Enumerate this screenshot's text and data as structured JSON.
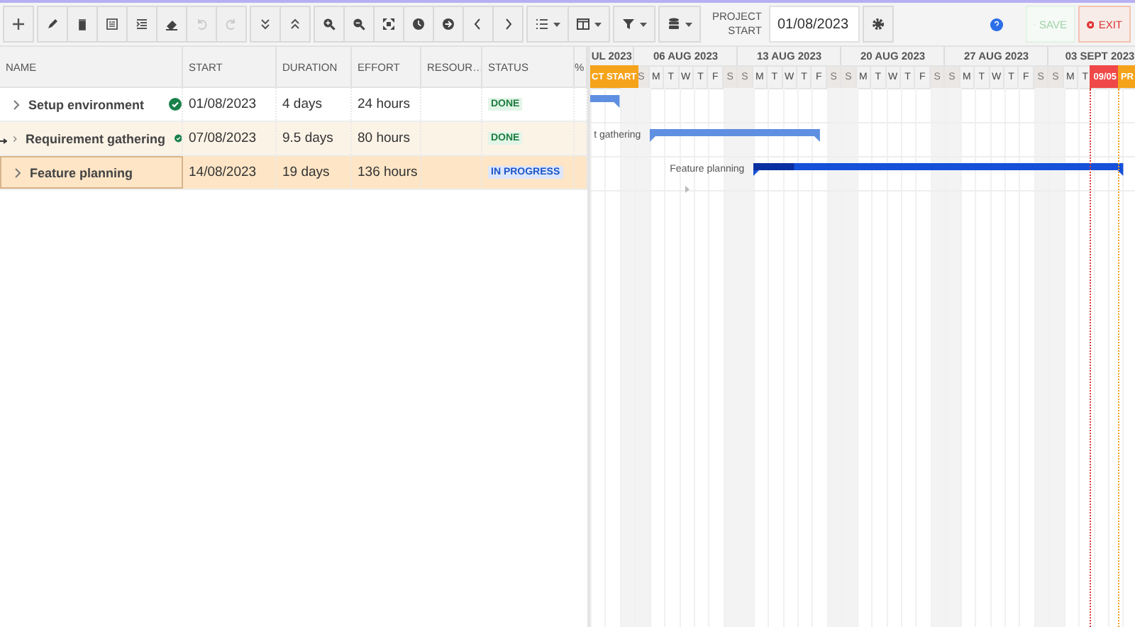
{
  "toolbar": {
    "groups": [
      [
        {
          "kind": "add",
          "disabled": false
        }
      ],
      [
        {
          "kind": "edit",
          "disabled": false
        },
        {
          "kind": "delete",
          "disabled": false
        },
        {
          "kind": "indent",
          "disabled": false
        },
        {
          "kind": "outdent",
          "disabled": false
        },
        {
          "kind": "erase",
          "disabled": false
        },
        {
          "kind": "undo",
          "disabled": true
        },
        {
          "kind": "redo",
          "disabled": true
        }
      ],
      [
        {
          "kind": "expand",
          "disabled": false
        },
        {
          "kind": "collapse",
          "disabled": false
        }
      ],
      [
        {
          "kind": "zoomin",
          "disabled": false
        },
        {
          "kind": "zoomout",
          "disabled": false
        },
        {
          "kind": "fit",
          "disabled": false
        },
        {
          "kind": "clock",
          "disabled": false
        },
        {
          "kind": "forward",
          "disabled": false
        },
        {
          "kind": "previous",
          "disabled": false
        },
        {
          "kind": "next",
          "disabled": false
        }
      ],
      [
        {
          "kind": "list",
          "disabled": false
        },
        {
          "kind": "columns",
          "disabled": false
        }
      ],
      [
        {
          "kind": "filter",
          "disabled": false
        }
      ],
      [
        {
          "kind": "database",
          "disabled": false
        }
      ]
    ],
    "project_start": {
      "label": "PROJECT START",
      "value": "01/08/2023"
    },
    "save": {
      "label": "SAVE",
      "disabled": true
    },
    "exit": {
      "label": "EXIT"
    }
  },
  "grid": {
    "columns": [
      "NAME",
      "START",
      "DURATION",
      "EFFORT",
      "RESOUR…",
      "STATUS",
      "%"
    ],
    "rows": [
      {
        "name": "Setup environment",
        "expanded": false,
        "start": "01/08/2023",
        "duration": "4 days",
        "effort": "24 hours",
        "status": "DONE",
        "kind": "done",
        "highlighted": false,
        "selected": false,
        "bar_label": ""
      },
      {
        "name": "Requirement gathering",
        "expanded": false,
        "start": "07/08/2023",
        "duration": "9.5 days",
        "effort": "80 hours",
        "status": "DONE",
        "kind": "done",
        "highlighted": true,
        "selected": false,
        "bar_label": "t gathering"
      },
      {
        "name": "Feature planning",
        "expanded": false,
        "start": "14/08/2023",
        "duration": "19 days",
        "effort": "136 hours",
        "status": "IN PROGRESS",
        "kind": "in_progress",
        "highlighted": false,
        "selected": true,
        "bar_label": "Feature planning",
        "level": 0.11
      }
    ]
  },
  "timeline": {
    "weeks": [
      {
        "label": "UL 2023"
      },
      {
        "label": "06 AUG 2023",
        "days": [
          "S",
          "M",
          "T",
          "W",
          "T",
          "F",
          "S"
        ]
      },
      {
        "label": "13 AUG 2023",
        "days": [
          "S",
          "M",
          "T",
          "W",
          "T",
          "F",
          "S"
        ]
      },
      {
        "label": "20 AUG 2023",
        "days": [
          "S",
          "M",
          "T",
          "W",
          "T",
          "F",
          "S"
        ]
      },
      {
        "label": "27 AUG 2023",
        "days": [
          "S",
          "M",
          "T",
          "W",
          "T",
          "F",
          "S"
        ]
      },
      {
        "label": "03 SEPT 2023",
        "days": [
          "S",
          "M",
          "T"
        ]
      }
    ],
    "markers": [
      {
        "kind": "project_start",
        "label": "CT START"
      },
      {
        "kind": "today",
        "label": "09/05"
      },
      {
        "kind": "project_end",
        "label": "PR"
      }
    ]
  }
}
